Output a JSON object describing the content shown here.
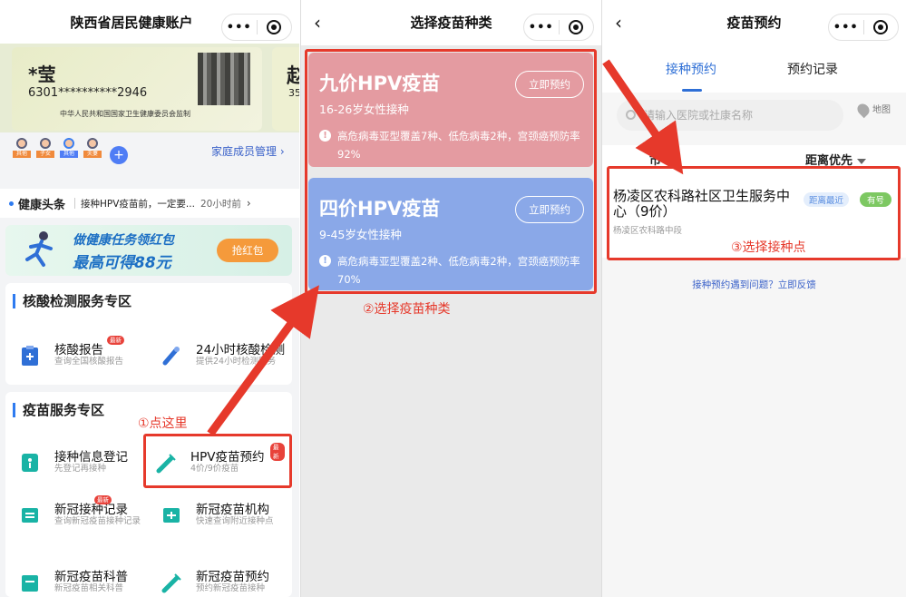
{
  "panel1": {
    "title": "陕西省居民健康账户",
    "card": {
      "name": "*莹",
      "number": "6301**********2946",
      "issuer": "中华人民共和国国家卫生健康委员会监制",
      "next_initial": "赵",
      "next_num": "35"
    },
    "family": {
      "members": [
        "其他",
        "子女",
        "其他",
        "夫妻"
      ],
      "manage_label": "家庭成员管理"
    },
    "news": {
      "label": "健康头条",
      "text": "接种HPV疫苗前，一定要...",
      "time": "20小时前"
    },
    "banner": {
      "line1": "做健康任务领红包",
      "line2": "最高可得88元",
      "button": "抢红包"
    },
    "section1": {
      "title": "核酸检测服务专区",
      "items": [
        {
          "name": "核酸报告",
          "desc": "查询全国核酸报告",
          "badge": "最新"
        },
        {
          "name": "24小时核酸检测",
          "desc": "提供24小时检测服务"
        }
      ]
    },
    "section2": {
      "title": "疫苗服务专区",
      "items": [
        {
          "name": "接种信息登记",
          "desc": "先登记再接种"
        },
        {
          "name": "HPV疫苗预约",
          "desc": "4价/9价疫苗",
          "badge": "最新"
        },
        {
          "name": "新冠接种记录",
          "desc": "查询新冠疫苗接种记录",
          "badge": "最新"
        },
        {
          "name": "新冠疫苗机构",
          "desc": "快速查询附近接种点"
        },
        {
          "name": "新冠疫苗科普",
          "desc": "新冠疫苗相关科普"
        },
        {
          "name": "新冠疫苗预约",
          "desc": "预约新冠疫苗接种"
        }
      ]
    },
    "annotation": "①点这里"
  },
  "panel2": {
    "title": "选择疫苗种类",
    "vaccines": [
      {
        "name": "九价HPV疫苗",
        "age": "16-26岁女性接种",
        "button": "立即预约",
        "desc": "高危病毒亚型覆盖7种、低危病毒2种，宫颈癌预防率92%"
      },
      {
        "name": "四价HPV疫苗",
        "age": "9-45岁女性接种",
        "button": "立即预约",
        "desc": "高危病毒亚型覆盖2种、低危病毒2种，宫颈癌预防率70%"
      }
    ],
    "annotation": "②选择疫苗种类"
  },
  "panel3": {
    "title": "疫苗预约",
    "tabs": [
      "接种预约",
      "预约记录"
    ],
    "search_placeholder": "请输入医院或社康名称",
    "map_label": "地图",
    "filter_city": "市",
    "filter_sort": "距离优先",
    "place": {
      "name": "杨凌区农科路社区卫生服务中心（9价）",
      "address": "杨凌区农科路中段",
      "near": "距离最近",
      "status": "有号"
    },
    "annotation": "③选择接种点",
    "feedback": "接种预约遇到问题？立即反馈"
  },
  "colors": {
    "highlight": "#e6392b",
    "accent": "#2e6fd6",
    "nine": "#e49ba1",
    "four": "#8aa8e8"
  }
}
